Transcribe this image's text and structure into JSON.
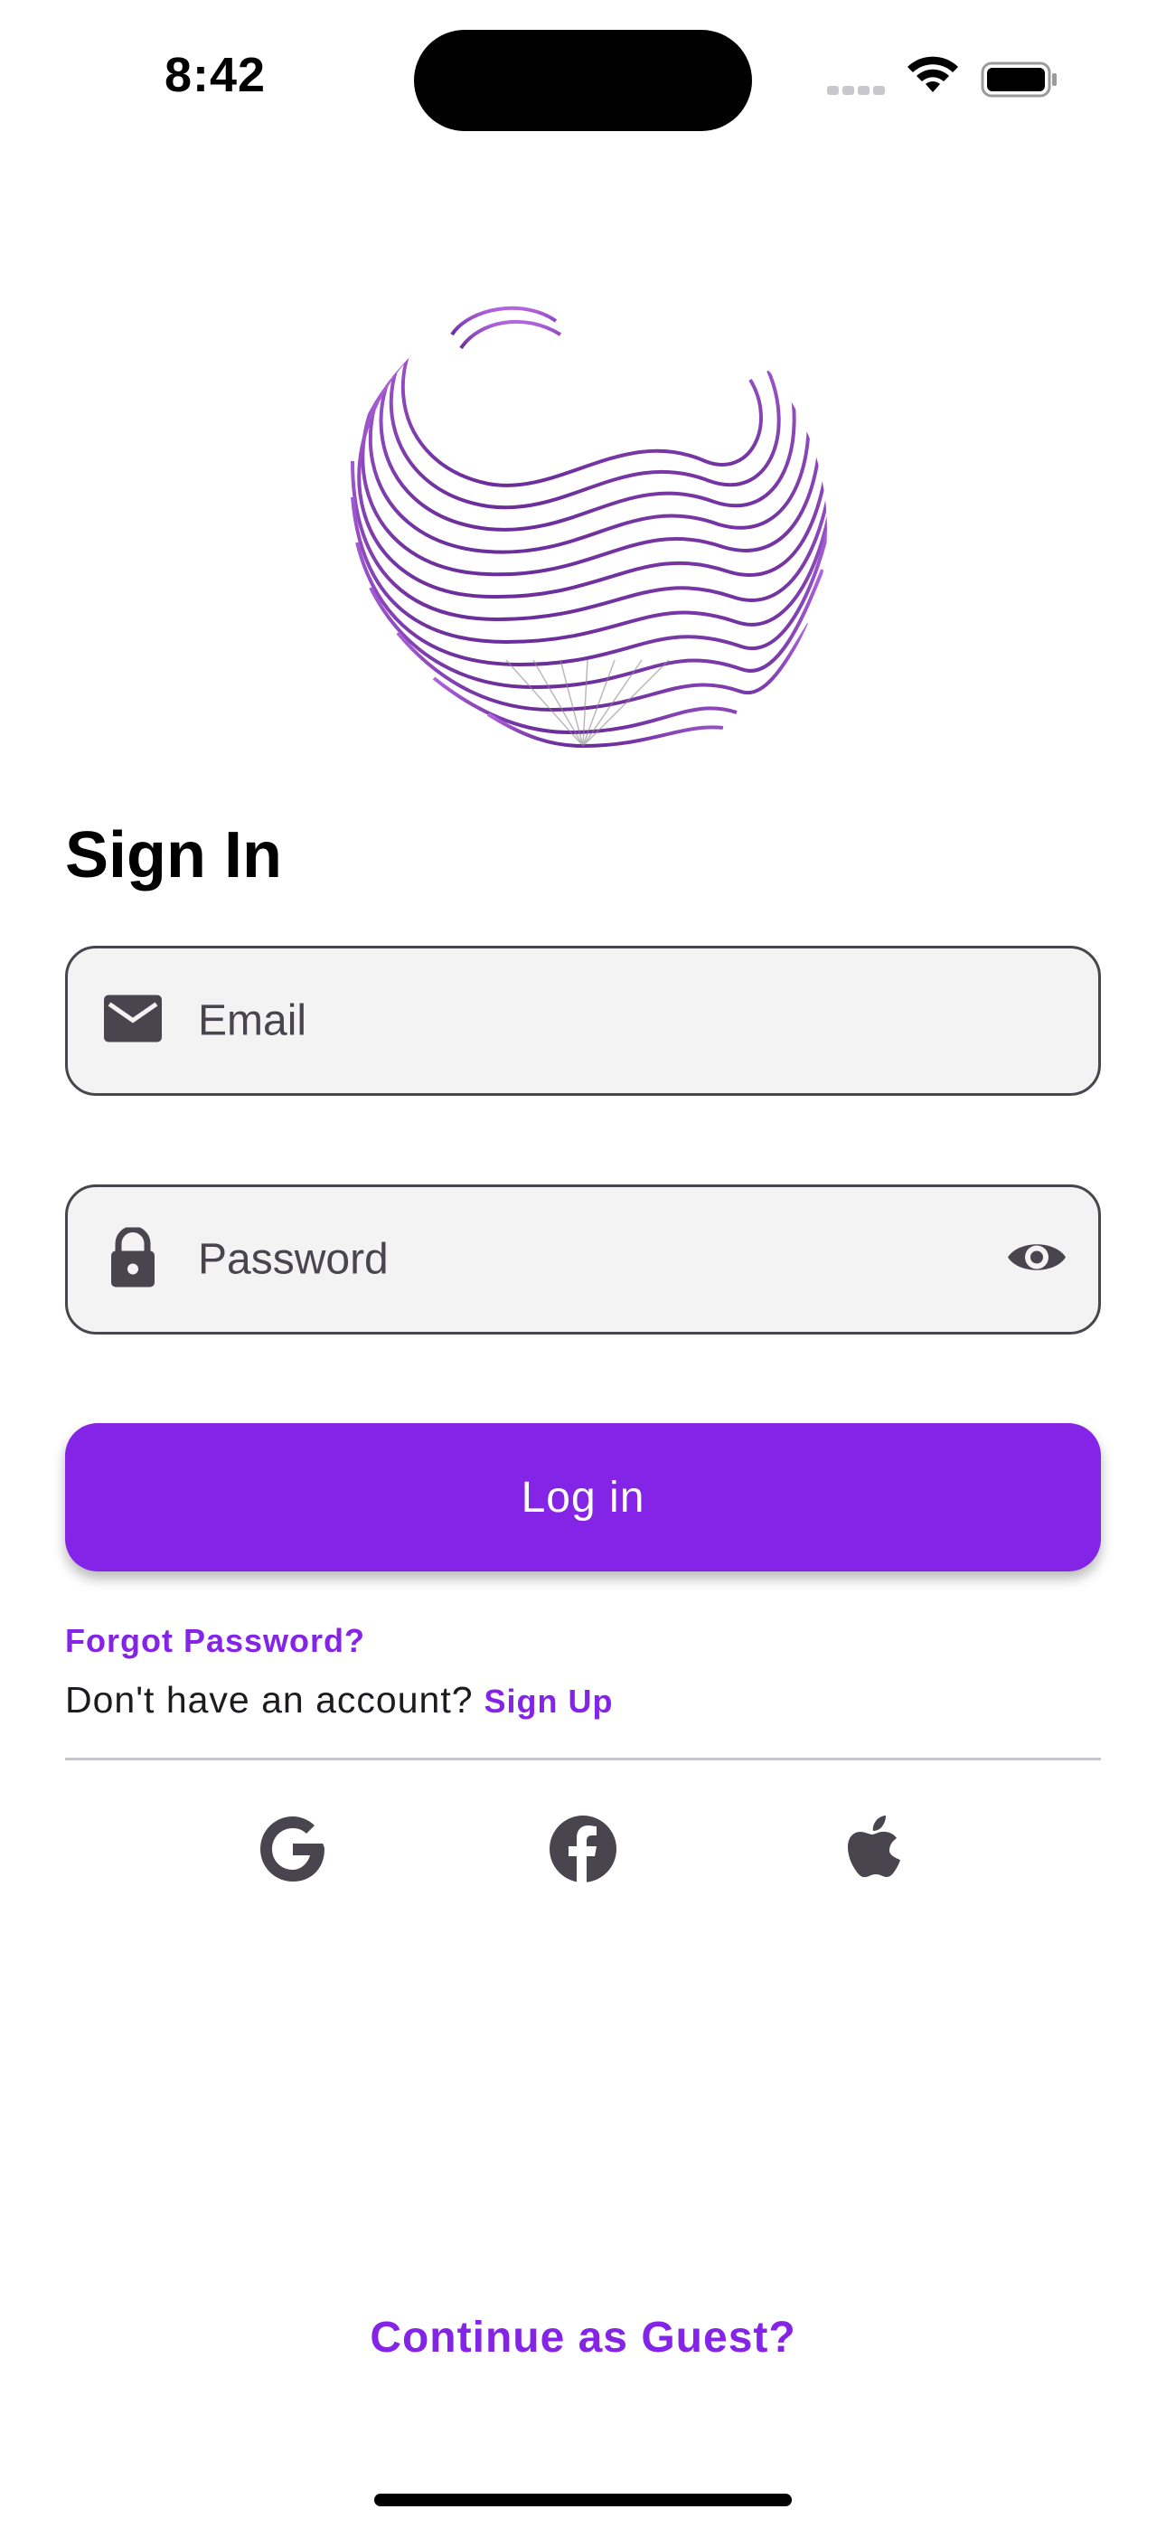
{
  "status_bar": {
    "time": "8:42"
  },
  "icons": {
    "email": "mail-icon",
    "password": "lock-icon",
    "visibility": "eye-icon",
    "google": "google-icon",
    "facebook": "facebook-icon",
    "apple": "apple-icon",
    "logo": "app-logo"
  },
  "colors": {
    "accent": "#8424e6",
    "field_bg": "#f3f3f3",
    "field_border": "#49454f",
    "divider": "#cac4d0"
  },
  "page": {
    "title": "Sign In"
  },
  "form": {
    "email_placeholder": "Email",
    "password_placeholder": "Password",
    "login_label": "Log in",
    "forgot_password": "Forgot Password?",
    "no_account_text": "Don't have an account?",
    "signup_link": "Sign Up"
  },
  "footer": {
    "guest_link": "Continue as Guest?"
  }
}
